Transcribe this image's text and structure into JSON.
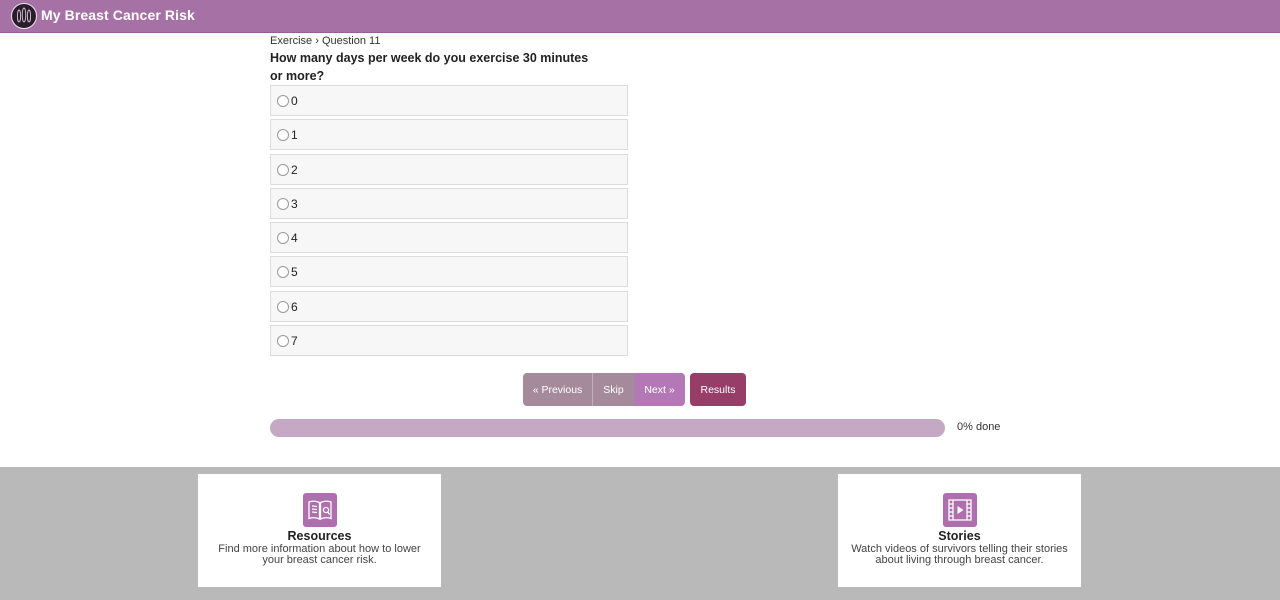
{
  "header": {
    "app_title": "My Breast Cancer Risk"
  },
  "breadcrumb": "Exercise › Question 11",
  "question": "How many days per week do you exercise 30 minutes or more?",
  "options": [
    "0",
    "1",
    "2",
    "3",
    "4",
    "5",
    "6",
    "7"
  ],
  "nav": {
    "previous": "« Previous",
    "skip": "Skip",
    "next": "Next »",
    "results": "Results"
  },
  "progress": {
    "percent": 0,
    "text": "0% done"
  },
  "cards": [
    {
      "icon": "book-search-icon",
      "title": "Resources",
      "description": "Find more information about how to lower your breast cancer risk."
    },
    {
      "icon": "video-film-icon",
      "title": "Stories",
      "description": "Watch videos of survivors telling their stories about living through breast cancer."
    }
  ],
  "colors": {
    "brand": "#a672a6",
    "results_button": "#963d68",
    "nav_button": "#a58a9c",
    "footer_bg": "#b9b9b9"
  }
}
